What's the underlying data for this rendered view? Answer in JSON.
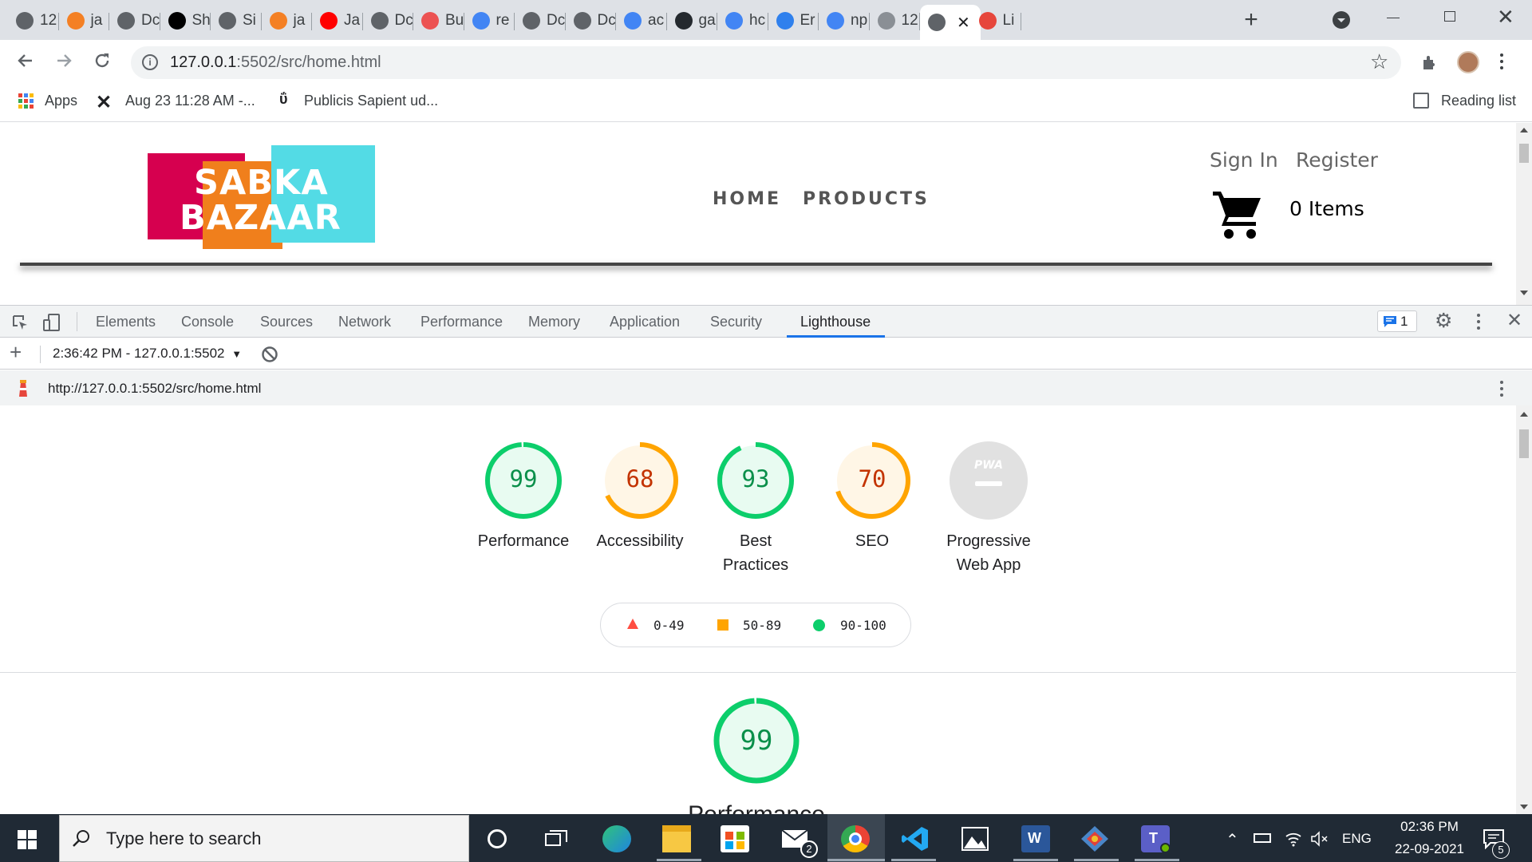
{
  "browser": {
    "tabs": [
      {
        "label": "12",
        "icon": "globe-icon",
        "color": "#5f6368"
      },
      {
        "label": "ja",
        "icon": "stackoverflow-icon",
        "color": "#f48024"
      },
      {
        "label": "Dc",
        "icon": "globe-icon",
        "color": "#5f6368"
      },
      {
        "label": "Sh",
        "icon": "codepen-icon",
        "color": "#000000"
      },
      {
        "label": "Si",
        "icon": "globe-icon",
        "color": "#5f6368"
      },
      {
        "label": "ja",
        "icon": "stackoverflow-icon",
        "color": "#f48024"
      },
      {
        "label": "Ja",
        "icon": "youtube-icon",
        "color": "#ff0000"
      },
      {
        "label": "Dc",
        "icon": "globe-icon",
        "color": "#5f6368"
      },
      {
        "label": "Bu",
        "icon": "udemy-icon",
        "color": "#ec5252"
      },
      {
        "label": "re",
        "icon": "google-icon",
        "color": "#4285f4"
      },
      {
        "label": "Dc",
        "icon": "globe-icon",
        "color": "#5f6368"
      },
      {
        "label": "Dc",
        "icon": "globe-icon",
        "color": "#5f6368"
      },
      {
        "label": "ac",
        "icon": "google-icon",
        "color": "#4285f4"
      },
      {
        "label": "ga",
        "icon": "github-icon",
        "color": "#24292e"
      },
      {
        "label": "hc",
        "icon": "google-icon",
        "color": "#4285f4"
      },
      {
        "label": "Er",
        "icon": "cube-icon",
        "color": "#2f80ed"
      },
      {
        "label": "np",
        "icon": "google-icon",
        "color": "#4285f4"
      },
      {
        "label": "12",
        "icon": "globe-icon",
        "color": "#8a8f95"
      },
      {
        "label": "",
        "icon": "globe-icon",
        "color": "#5f6368"
      },
      {
        "label": "Li",
        "icon": "lighthouse-icon",
        "color": "#e6463c"
      }
    ],
    "url_host": "127.0.0.1",
    "url_path": ":5502/src/home.html",
    "bookmarks": {
      "apps": "Apps",
      "item1": "Aug 23 11:28 AM -...",
      "item2": "Publicis Sapient ud...",
      "reading_list": "Reading list"
    }
  },
  "site": {
    "logo_line1": "SABKA",
    "logo_line2": "BAZAAR",
    "nav": [
      "HOME",
      "PRODUCTS"
    ],
    "sign_in": "Sign In",
    "register": "Register",
    "cart": "0 Items"
  },
  "devtools": {
    "tabs": [
      "Elements",
      "Console",
      "Sources",
      "Network",
      "Performance",
      "Memory",
      "Application",
      "Security",
      "Lighthouse"
    ],
    "active_tab": "Lighthouse",
    "issues_count": "1",
    "report_selector": "2:36:42 PM - 127.0.0.1:5502",
    "report_url": "http://127.0.0.1:5502/src/home.html"
  },
  "lighthouse": {
    "gauges": [
      {
        "score": 99,
        "label": "Performance",
        "color": "#0cce6b",
        "bg": "#e8fbf1"
      },
      {
        "score": 68,
        "label": "Accessibility",
        "color": "#ffa400",
        "bg": "#fff6e6"
      },
      {
        "score": 93,
        "label": "Best Practices",
        "color": "#0cce6b",
        "bg": "#e8fbf1"
      },
      {
        "score": 70,
        "label": "SEO",
        "color": "#ffa400",
        "bg": "#fff6e6"
      }
    ],
    "pwa_label": "Progressive Web App",
    "pwa_badge": "PWA",
    "legend": [
      "0-49",
      "50-89",
      "90-100"
    ],
    "big_score": 99,
    "big_label": "Performance"
  },
  "taskbar": {
    "search_placeholder": "Type here to search",
    "lang": "ENG",
    "time": "02:36 PM",
    "date": "22-09-2021",
    "mail_badge": "2",
    "notif_badge": "5"
  }
}
